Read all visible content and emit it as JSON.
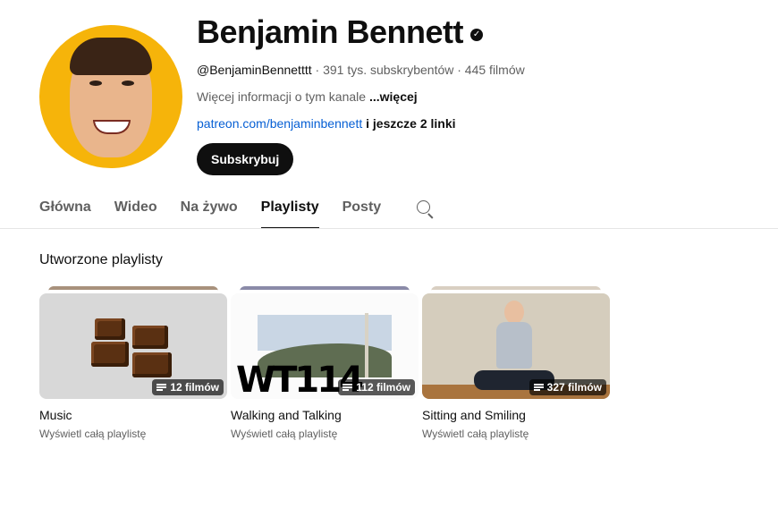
{
  "channel": {
    "name": "Benjamin Bennett",
    "verified_icon": "checkmark-circle-icon",
    "handle": "@BenjaminBennetttt",
    "stats": " · 391 tys. subskrybentów · 445 filmów",
    "description": "Więcej informacji o tym kanale ",
    "more_label": "...więcej",
    "link": "patreon.com/benjaminbennett",
    "extra_links": " i jeszcze 2 linki",
    "subscribe_label": "Subskrybuj"
  },
  "tabs": [
    "Główna",
    "Wideo",
    "Na żywo",
    "Playlisty",
    "Posty"
  ],
  "active_tab": "Playlisty",
  "section": {
    "title": "Utworzone playlisty"
  },
  "playlists": [
    {
      "title": "Music",
      "count": "12 filmów",
      "view_all": "Wyświetl całą playlistę",
      "stack_color": "#a8917c"
    },
    {
      "title": "Walking and Talking",
      "count": "112 filmów",
      "view_all": "Wyświetl całą playlistę",
      "stack_color": "#8a8aa8",
      "thumb_text": "WT114"
    },
    {
      "title": "Sitting and Smiling",
      "count": "327 filmów",
      "view_all": "Wyświetl całą playlistę",
      "stack_color": "#d9cfc2"
    }
  ],
  "colors": {
    "avatar_bg": "#f6b40a",
    "link": "#065fd4",
    "subscribe_bg": "#0f0f0f",
    "secondary_text": "#606060"
  }
}
